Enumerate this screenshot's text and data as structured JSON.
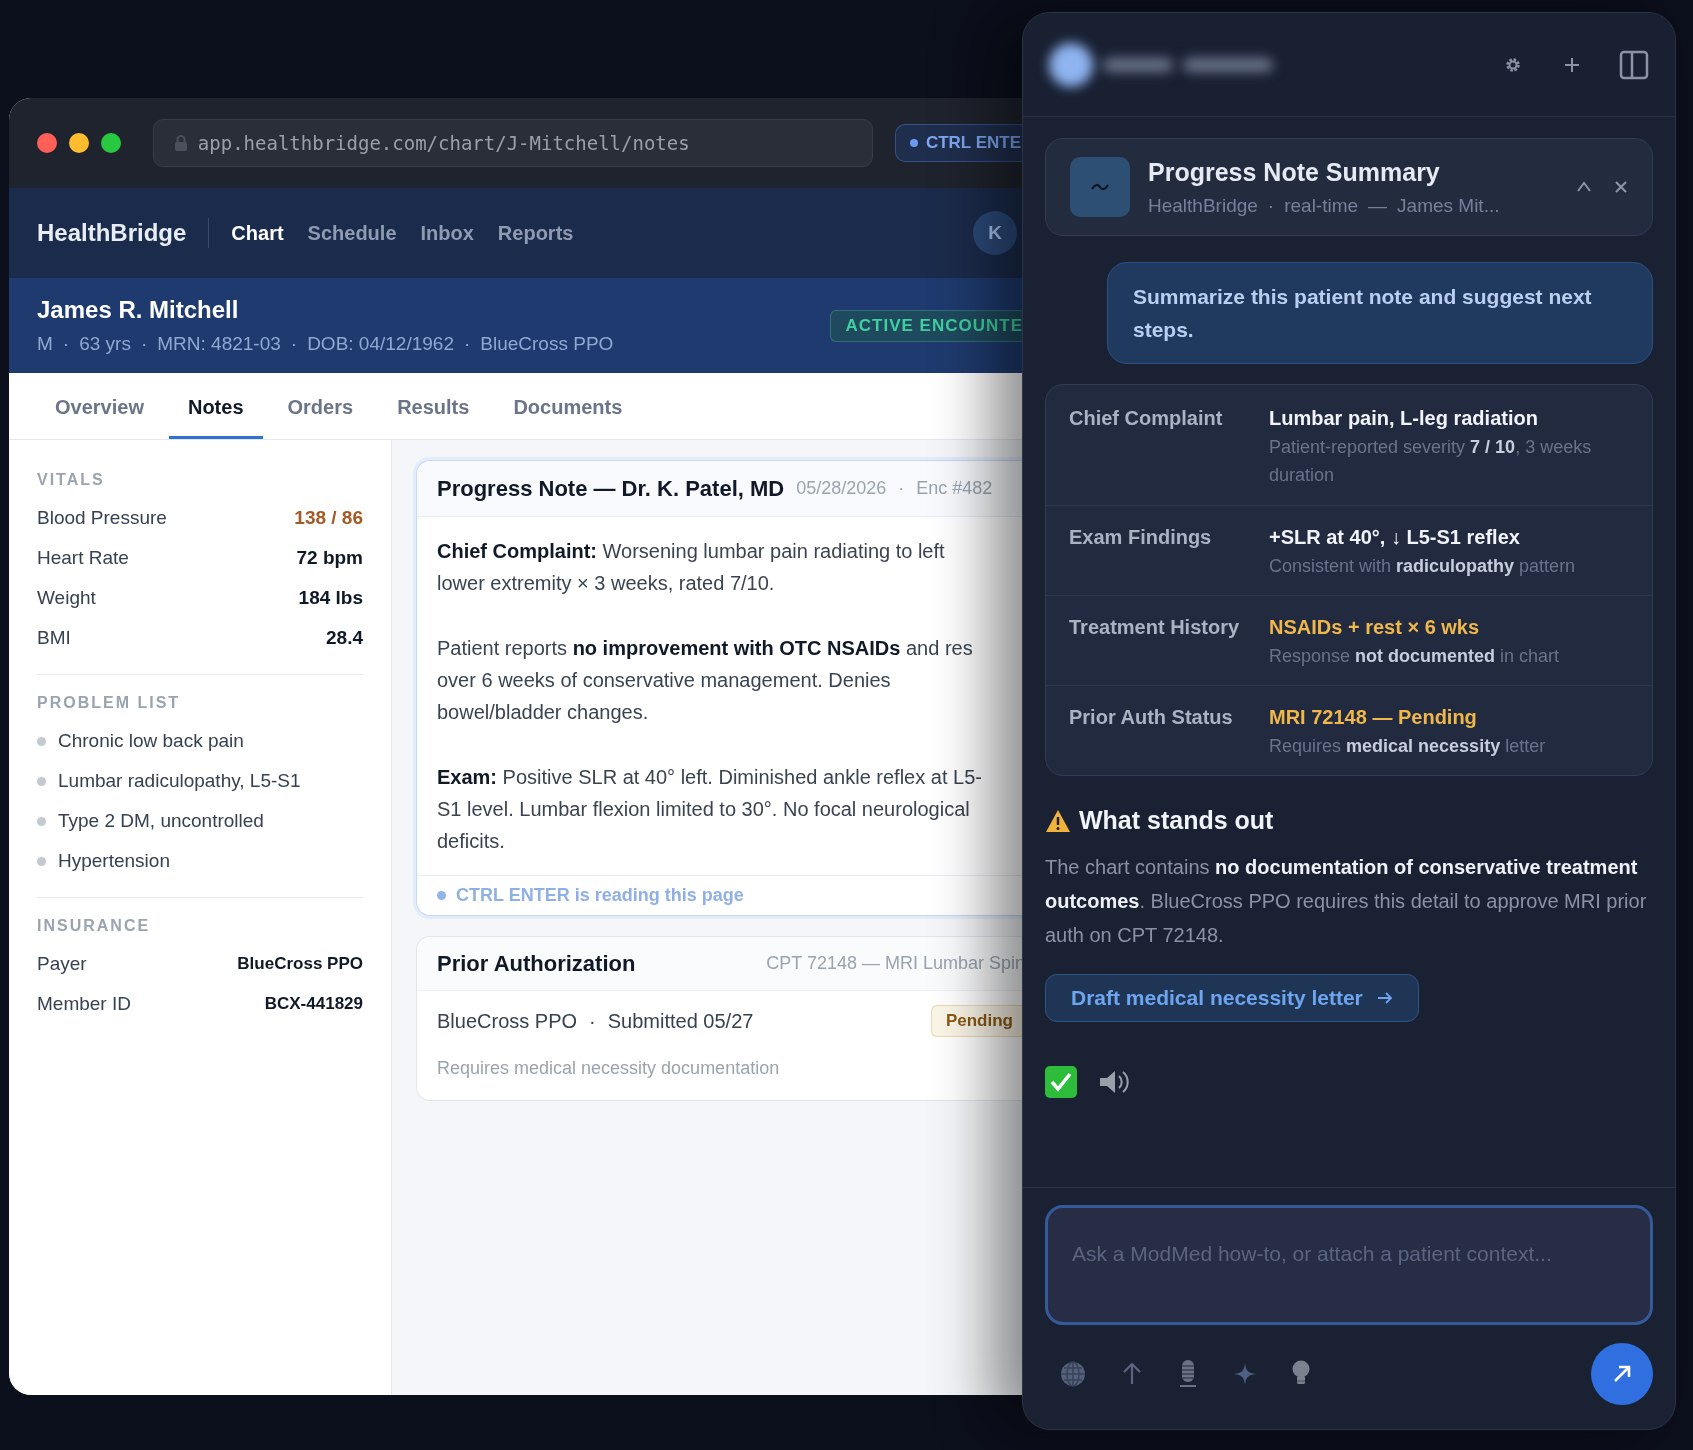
{
  "browser": {
    "url": "app.healthbridge.com/chart/J-Mitchell/notes",
    "extension_badge": "CTRL ENTE"
  },
  "app_nav": {
    "brand": "HealthBridge",
    "items": [
      {
        "label": "Chart",
        "selected": true
      },
      {
        "label": "Schedule",
        "selected": false
      },
      {
        "label": "Inbox",
        "selected": false
      },
      {
        "label": "Reports",
        "selected": false
      }
    ],
    "avatar_initial": "K"
  },
  "patient": {
    "name": "James R. Mitchell",
    "meta": [
      "M",
      "63 yrs",
      "MRN: 4821-03",
      "DOB: 04/12/1962",
      "BlueCross PPO"
    ],
    "meta_separator": "·",
    "badge": "ACTIVE ENCOUNTE"
  },
  "tabs": [
    {
      "label": "Overview",
      "selected": false
    },
    {
      "label": "Notes",
      "selected": true
    },
    {
      "label": "Orders",
      "selected": false
    },
    {
      "label": "Results",
      "selected": false
    },
    {
      "label": "Documents",
      "selected": false
    }
  ],
  "sidebar": {
    "sections": [
      {
        "kind": "vitals",
        "heading": "VITALS",
        "items": [
          {
            "label": "Blood Pressure",
            "value": "138 / 86",
            "flagged": true
          },
          {
            "label": "Heart Rate",
            "value": "72 bpm",
            "flagged": false
          },
          {
            "label": "Weight",
            "value": "184 lbs",
            "flagged": false
          },
          {
            "label": "BMI",
            "value": "28.4",
            "flagged": false
          }
        ]
      },
      {
        "kind": "bullets",
        "heading": "PROBLEM LIST",
        "items": [
          {
            "label": "Chronic low back pain"
          },
          {
            "label": "Lumbar radiculopathy, L5-S1"
          },
          {
            "label": "Type 2 DM, uncontrolled"
          },
          {
            "label": "Hypertension"
          }
        ]
      },
      {
        "kind": "insurance",
        "heading": "INSURANCE",
        "items": [
          {
            "label": "Payer",
            "value": "BlueCross PPO"
          },
          {
            "label": "Member ID",
            "value": "BCX-441829"
          }
        ]
      }
    ]
  },
  "progress_note": {
    "title": "Progress Note — Dr. K. Patel, MD",
    "date": "05/28/2026",
    "separator": "·",
    "encounter": "Enc #482",
    "paragraphs": [
      "**Chief Complaint:** Worsening lumbar pain radiating to left lower extremity × 3 weeks, rated 7/10.",
      "Patient reports **no improvement with OTC NSAIDs** and res over 6 weeks of conservative management. Denies bowel/bladder changes.",
      "**Exam:** Positive SLR at 40° left. Diminished ankle reflex at L5-S1 level. Lumbar flexion limited to 30°. No focal neurological deficits."
    ],
    "reading_notice": "CTRL ENTER is reading this page"
  },
  "prior_auth": {
    "title": "Prior Authorization",
    "code": "CPT 72148 — MRI Lumbar Spin",
    "payer": "BlueCross PPO",
    "separator": "·",
    "submitted": "Submitted 05/27",
    "status": "Pending",
    "note": "Requires medical necessity documentation"
  },
  "assistant": {
    "summary_card": {
      "title": "Progress Note Summary",
      "source": "HealthBridge",
      "separator": "·",
      "mode": "real-time",
      "dash": "—",
      "patient": "James Mit..."
    },
    "user_message": "Summarize this patient note and suggest next steps.",
    "summary_rows": [
      {
        "label": "Chief Complaint",
        "value": "Lumbar pain, L-leg radiation",
        "flagged": false,
        "detail": "Patient-reported severity **7 / 10**, 3 weeks duration"
      },
      {
        "label": "Exam Findings",
        "value": "+SLR at 40°, ↓ L5-S1 reflex",
        "flagged": false,
        "detail": "Consistent with **radiculopathy** pattern"
      },
      {
        "label": "Treatment History",
        "value": "NSAIDs + rest × 6 wks",
        "flagged": true,
        "detail": "Response **not documented** in chart"
      },
      {
        "label": "Prior Auth Status",
        "value": "MRI 72148 — Pending",
        "flagged": true,
        "detail": "Requires **medical necessity** letter"
      }
    ],
    "alert": {
      "heading": "What stands out",
      "body": "The chart contains **no documentation of conservative treatment outcomes**. BlueCross PPO requires this detail to approve MRI prior auth on CPT 72148."
    },
    "action": "Draft medical necessity letter",
    "input_placeholder": "Ask a ModMed how-to, or attach a patient context..."
  }
}
